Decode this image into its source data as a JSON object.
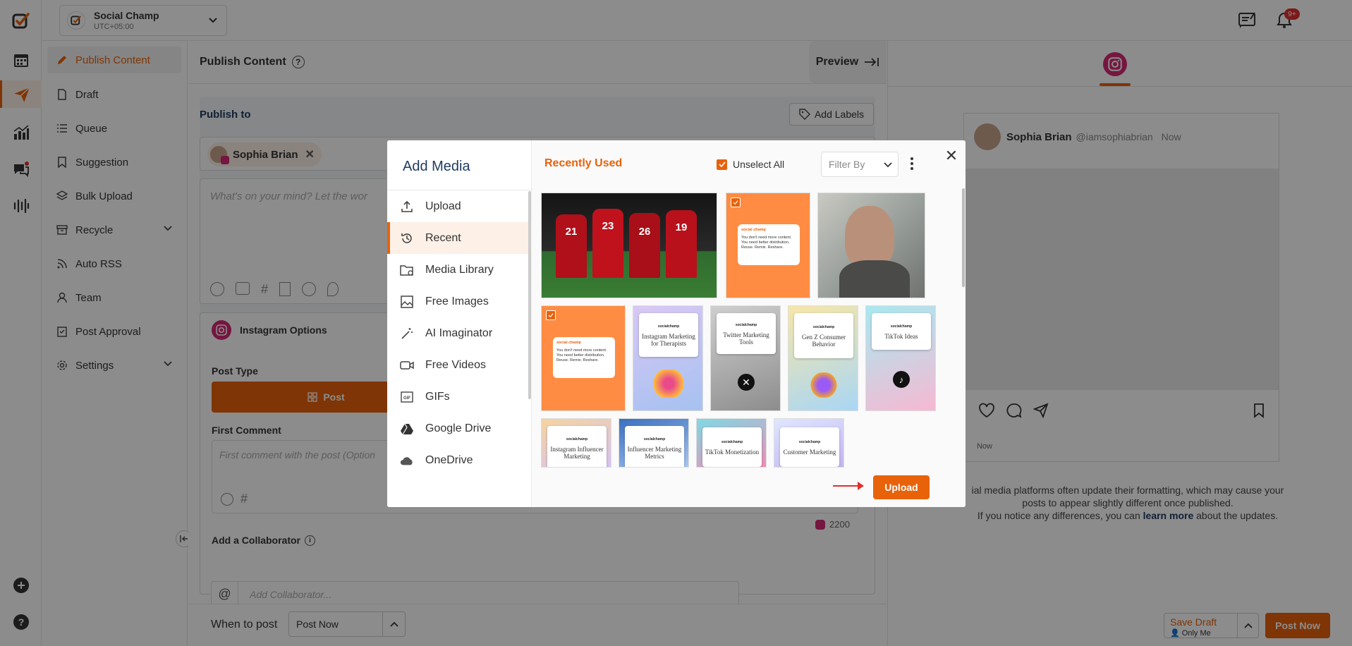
{
  "workspace": {
    "name": "Social Champ",
    "timezone": "UTC+05:00"
  },
  "header": {
    "notif_badge": "9+"
  },
  "nav": {
    "items": [
      {
        "label": "Publish Content",
        "icon": "pencil-icon"
      },
      {
        "label": "Draft",
        "icon": "document-icon"
      },
      {
        "label": "Queue",
        "icon": "list-icon"
      },
      {
        "label": "Suggestion",
        "icon": "bookmark-icon"
      },
      {
        "label": "Bulk Upload",
        "icon": "layers-icon"
      },
      {
        "label": "Recycle",
        "icon": "recycle-icon"
      },
      {
        "label": "Auto RSS",
        "icon": "rss-icon"
      },
      {
        "label": "Team",
        "icon": "user-icon"
      },
      {
        "label": "Post Approval",
        "icon": "clipboard-icon"
      },
      {
        "label": "Settings",
        "icon": "gear-icon"
      }
    ]
  },
  "composer": {
    "title": "Publish Content",
    "preview_label": "Preview",
    "publish_to": "Publish to",
    "add_labels": "Add Labels",
    "account_chip": "Sophia Brian",
    "placeholder": "What's on your mind? Let the wor",
    "instagram_options": "Instagram Options",
    "post_type_label": "Post Type",
    "post_type_value": "Post",
    "first_comment_label": "First Comment",
    "first_comment_placeholder": "First comment with the post (Option",
    "char_count": "2200",
    "collaborator_label": "Add a Collaborator",
    "collaborator_placeholder": "Add Collaborator..."
  },
  "footer": {
    "when_to_post": "When to post",
    "schedule_value": "Post Now",
    "save_draft": "Save Draft",
    "save_draft_sub": "Only Me",
    "post_now": "Post Now"
  },
  "preview": {
    "name": "Sophia Brian",
    "handle": "@iamsophiabrian",
    "time": "Now",
    "time_small": "Now",
    "notice_line1": "ial media platforms often update their formatting, which may cause your",
    "notice_line2": "posts to appear slightly different once published.",
    "notice_line3_pre": "If you notice any differences, you can",
    "notice_link": "learn more",
    "notice_line3_post": "about the updates."
  },
  "modal": {
    "title": "Add Media",
    "menu": [
      {
        "label": "Upload",
        "icon": "upload-icon"
      },
      {
        "label": "Recent",
        "icon": "history-icon"
      },
      {
        "label": "Media Library",
        "icon": "folder-icon"
      },
      {
        "label": "Free Images",
        "icon": "image-icon"
      },
      {
        "label": "AI Imaginator",
        "icon": "magic-wand-icon"
      },
      {
        "label": "Free Videos",
        "icon": "video-icon"
      },
      {
        "label": "GIFs",
        "icon": "gif-icon"
      },
      {
        "label": "Google Drive",
        "icon": "google-drive-icon"
      },
      {
        "label": "OneDrive",
        "icon": "onedrive-icon"
      }
    ],
    "section_title": "Recently Used",
    "unselect_all": "Unselect All",
    "filter_placeholder": "Filter By",
    "upload_button": "Upload",
    "card_brand": "socialchamp",
    "quote_card": {
      "brand": "social champ",
      "text": "You don't need more content. You need better distribution.",
      "footer": "Reuse. Remix. Reshare."
    },
    "cards": [
      "Instagram Marketing for Therapists",
      "Twitter Marketing Tools",
      "Gen Z Consumer Behavior",
      "TikTok Ideas",
      "Instagram Influencer Marketing",
      "Influencer Marketing Metrics",
      "TikTok Monetization",
      "Customer Marketing"
    ],
    "player_numbers": [
      "21",
      "23",
      "26",
      "19"
    ]
  }
}
